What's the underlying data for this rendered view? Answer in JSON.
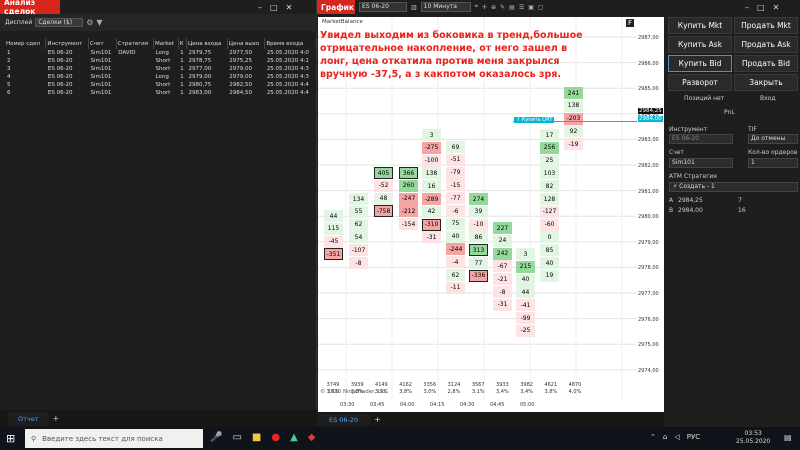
{
  "left": {
    "title": "Анализ сделок",
    "display_label": "Дисплей",
    "display_value": "Сделки ($)",
    "footer_tab": "Отчет",
    "footer_add": "+",
    "headers": [
      "Номер сдел",
      "Инструмент",
      "Счет",
      "Стратегия",
      "Market",
      "К",
      "Цена входа",
      "Цена выхо",
      "Время входа"
    ],
    "rows": [
      [
        "1",
        "ES 06-20",
        "Sim101",
        "DAVID",
        "Long",
        "1",
        "2979,75",
        "2977,50",
        "25.05.2020 4:0"
      ],
      [
        "2",
        "ES 06-20",
        "Sim101",
        "",
        "Short",
        "1",
        "2978,75",
        "2975,25",
        "25.05.2020 4:1"
      ],
      [
        "3",
        "ES 06-20",
        "Sim101",
        "",
        "Short",
        "1",
        "2977,00",
        "2979,00",
        "25.05.2020 4:3"
      ],
      [
        "4",
        "ES 06-20",
        "Sim101",
        "",
        "Long",
        "1",
        "2979,00",
        "2979,00",
        "25.05.2020 4:3"
      ],
      [
        "5",
        "ES 06-20",
        "Sim101",
        "",
        "Short",
        "1",
        "2980,75",
        "2982,50",
        "25.05.2020 4:4"
      ],
      [
        "6",
        "ES 06-20",
        "Sim101",
        "",
        "Short",
        "1",
        "2983,00",
        "2984,50",
        "25.05.2020 4:4"
      ]
    ]
  },
  "chart": {
    "title": "График",
    "instrument": "ES 06-20",
    "interval": "10 Минута",
    "indicator": "MarketBalance",
    "tab": "ES 06-20",
    "tab_add": "+",
    "f": "F",
    "annotation": "Увидел выходим из боковика в тренд,большое отрицательное накопление, от него зашел в лонг, цена откатила против меня закрылся вручную -37,5, а з какпотом оказалось зря.",
    "order_label": "↑ Купить LMT",
    "price_labels": [
      "2987,00",
      "2986,00",
      "2985,00",
      "2984,00",
      "2983,00",
      "2982,00",
      "2981,00",
      "2980,00",
      "2979,00",
      "2978,00",
      "2977,00",
      "2976,00",
      "2975,00",
      "2974,00"
    ],
    "price_badge": "2984,25",
    "price_badge2": "2984,00",
    "volumes": [
      [
        "3749",
        "3,6%"
      ],
      [
        "3939",
        "3,8%"
      ],
      [
        "4149",
        "3,9%"
      ],
      [
        "4162",
        "3,8%"
      ],
      [
        "3356",
        "3,0%"
      ],
      [
        "3124",
        "2,8%"
      ],
      [
        "3567",
        "3,1%"
      ],
      [
        "3933",
        "3,4%"
      ],
      [
        "3982",
        "3,4%"
      ],
      [
        "4621",
        "3,8%"
      ],
      [
        "4870",
        "4,0%"
      ]
    ],
    "times": [
      "03:30",
      "03:45",
      "04:00",
      "04:15",
      "04:30",
      "04:45",
      "05:00"
    ],
    "copyright": "© 2020 NinjaTrader, LLC"
  },
  "right": {
    "buy_mkt": "Купить Mkt",
    "sell_mkt": "Продать Mkt",
    "buy_ask": "Купить Ask",
    "sell_ask": "Продать Ask",
    "buy_bid": "Купить Bid",
    "sell_bid": "Продать Bid",
    "reverse": "Разворот",
    "close": "Закрыть",
    "position_label": "Позиций нет",
    "entry_label": "Вход",
    "pnl_label": "PnL",
    "instrument_label": "Инструмент",
    "instrument_value": "ES 06-20",
    "tif_label": "TIF",
    "tif_value": "До отмены",
    "account_label": "Счет",
    "account_value": "Sim101",
    "qty_label": "Кол-во ордеров",
    "qty_value": "1",
    "atm_label": "АТМ Стратегия",
    "atm_value": "Создать - 1",
    "a_label": "A",
    "a_value": "2984,25",
    "a_qty": "7",
    "b_label": "B",
    "b_value": "2984,00",
    "b_qty": "16"
  },
  "taskbar": {
    "search": "Введите здесь текст для поиска",
    "lang": "РУС",
    "time": "03:53",
    "date": "25.05.2020"
  }
}
